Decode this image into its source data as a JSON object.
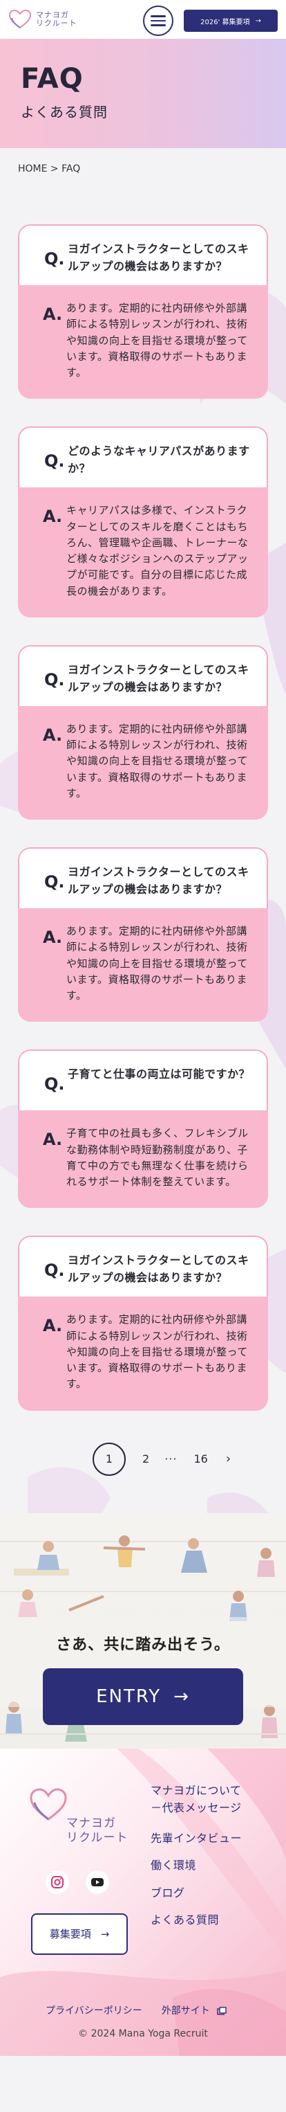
{
  "header": {
    "logo_line1": "マナヨガ",
    "logo_line2": "リクルート",
    "recruit_button": "2026' 募集要項"
  },
  "hero": {
    "title": "FAQ",
    "subtitle": "よくある質問"
  },
  "breadcrumb": "HOME > FAQ",
  "faq": [
    {
      "q_mark": "Q.",
      "question": "ヨガインストラクターとしてのスキルアップの機会はありますか？",
      "a_mark": "A.",
      "answer": "あります。定期的に社内研修や外部講師による特別レッスンが行われ、技術や知識の向上を目指せる環境が整っています。資格取得のサポートもあります。"
    },
    {
      "q_mark": "Q.",
      "question": "どのようなキャリアパスがありますか？",
      "a_mark": "A.",
      "answer": "キャリアパスは多様で、インストラクターとしてのスキルを磨くことはもちろん、管理職や企画職、トレーナーなど様々なポジションへのステップアップが可能です。自分の目標に応じた成長の機会があります。"
    },
    {
      "q_mark": "Q.",
      "question": "ヨガインストラクターとしてのスキルアップの機会はありますか？",
      "a_mark": "A.",
      "answer": "あります。定期的に社内研修や外部講師による特別レッスンが行われ、技術や知識の向上を目指せる環境が整っています。資格取得のサポートもあります。"
    },
    {
      "q_mark": "Q.",
      "question": "ヨガインストラクターとしてのスキルアップの機会はありますか？",
      "a_mark": "A.",
      "answer": "あります。定期的に社内研修や外部講師による特別レッスンが行われ、技術や知識の向上を目指せる環境が整っています。資格取得のサポートもあります。"
    },
    {
      "q_mark": "Q.",
      "question": "子育てと仕事の両立は可能ですか？",
      "a_mark": "A.",
      "answer": "子育て中の社員も多く、フレキシブルな勤務体制や時短勤務制度があり、子育て中の方でも無理なく仕事を続けられるサポート体制を整えています。"
    },
    {
      "q_mark": "Q.",
      "question": "ヨガインストラクターとしてのスキルアップの機会はありますか？",
      "a_mark": "A.",
      "answer": "あります。定期的に社内研修や外部講師による特別レッスンが行われ、技術や知識の向上を目指せる環境が整っています。資格取得のサポートもあります。"
    }
  ],
  "pagination": {
    "current": "1",
    "next_page": "2",
    "dots": "···",
    "last": "16"
  },
  "cta": {
    "text": "さあ、共に踏み出そう。",
    "button": "ENTRY"
  },
  "footer": {
    "logo_line1": "マナヨガ",
    "logo_line2": "リクルート",
    "recruit_button": "募集要項",
    "nav": [
      "マナヨガについて",
      "－代表メッセージ",
      "先輩インタビュー",
      "働く環境",
      "ブログ",
      "よくある質問"
    ],
    "privacy": "プライバシーポリシー",
    "external": "外部サイト",
    "copyright": "© 2024 Mana Yoga Recruit"
  },
  "colors": {
    "navy": "#2c2e77",
    "pink": "#f9b8cd",
    "pink_border": "#f7a9c3",
    "logo_purple": "#6d5aa0"
  },
  "icons": [
    "heart-logo-icon",
    "hamburger-icon",
    "arrow-right-icon",
    "chevron-right-icon",
    "instagram-icon",
    "youtube-icon",
    "external-link-icon"
  ]
}
